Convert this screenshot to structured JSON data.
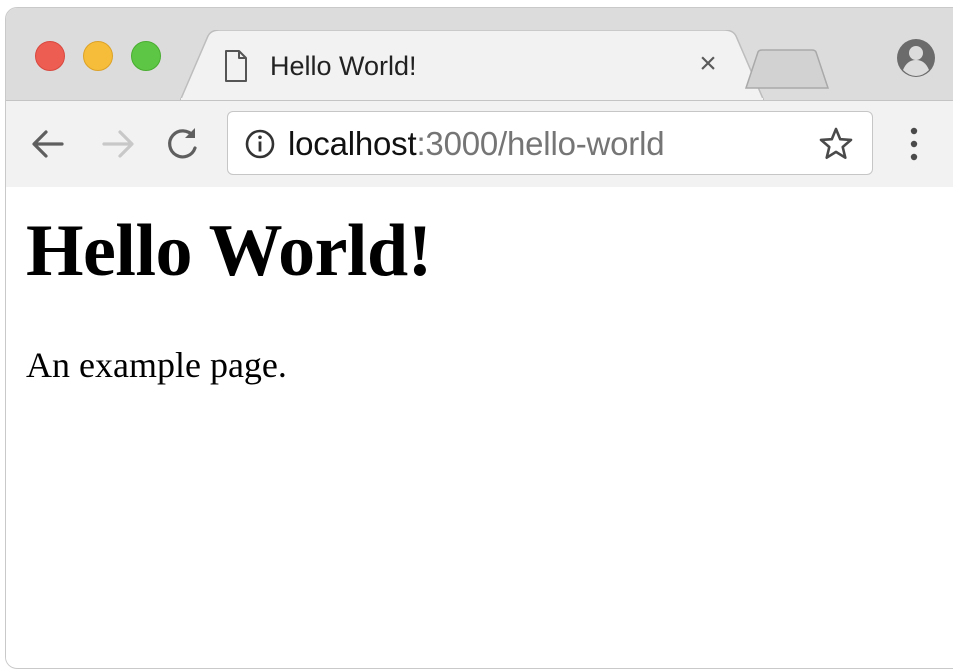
{
  "window": {
    "traffic_lights": {
      "close": "#ee5d52",
      "minimize": "#f6bd3a",
      "zoom": "#5ec645"
    }
  },
  "tab": {
    "icon": "page-icon",
    "title": "Hello World!",
    "close_symbol": "×"
  },
  "toolbar": {
    "back_icon": "arrow-left-icon",
    "forward_icon": "arrow-right-icon",
    "reload_icon": "reload-icon",
    "address": {
      "site_info_icon": "info-icon",
      "host": "localhost",
      "path": ":3000/hello-world",
      "bookmark_icon": "star-icon"
    },
    "menu_icon": "vertical-dots-icon"
  },
  "page": {
    "heading": "Hello World!",
    "paragraph": "An example page."
  }
}
